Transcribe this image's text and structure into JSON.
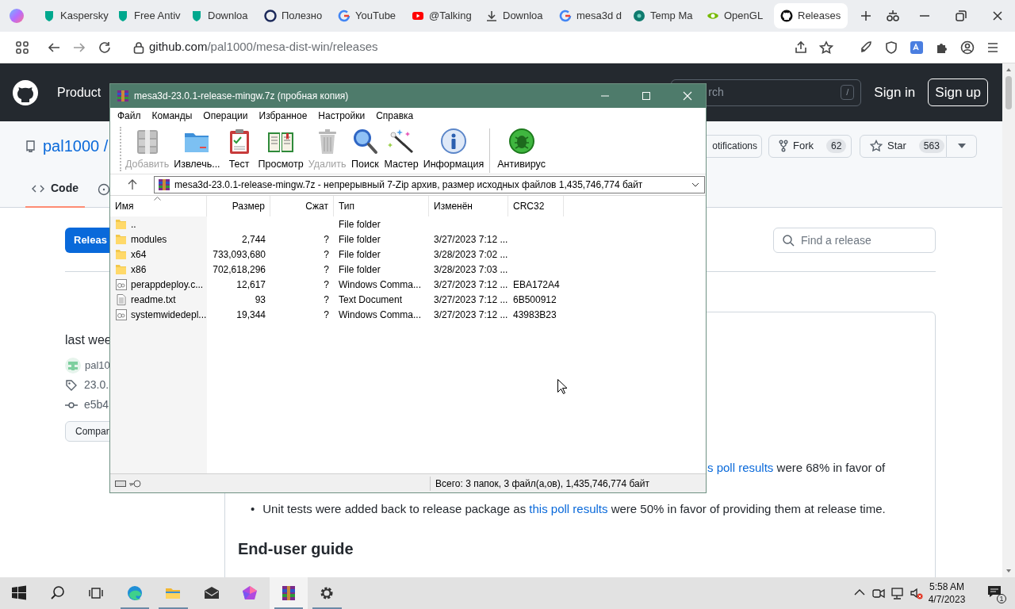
{
  "browser": {
    "tabs": [
      {
        "label": "Kaspersky",
        "selected": false
      },
      {
        "label": "Free Antiv",
        "selected": false
      },
      {
        "label": "Downloa",
        "selected": false
      },
      {
        "label": "Полезно",
        "selected": false
      },
      {
        "label": "YouTube",
        "selected": false
      },
      {
        "label": "@Talking",
        "selected": false
      },
      {
        "label": "Downloa",
        "selected": false
      },
      {
        "label": "mesa3d d",
        "selected": false
      },
      {
        "label": "Temp Ma",
        "selected": false
      },
      {
        "label": "OpenGL",
        "selected": false
      },
      {
        "label": "Releases",
        "selected": true
      }
    ],
    "url": {
      "host": "github.com",
      "path": "/pal1000/mesa-dist-win/releases"
    }
  },
  "github": {
    "header": {
      "menu": "Product",
      "search_text": "rch",
      "search_key": "/",
      "sign_in": "Sign in",
      "sign_up": "Sign up"
    },
    "repo": {
      "owner": "pal1000 /",
      "notifications": "otifications",
      "fork": {
        "label": "Fork",
        "count": "62"
      },
      "star": {
        "label": "Star",
        "count": "563"
      },
      "tabs": [
        {
          "label": "Code",
          "selected": true
        }
      ]
    },
    "releases_button": "Releas",
    "find_placeholder": "Find a release",
    "release": {
      "time": "last wee",
      "author": "pal10",
      "tag": "23.0.",
      "commit": "e5b4",
      "compare": "Compar"
    },
    "notes": {
      "partial_line": [
        {
          "text": "s poll results",
          "link": true
        },
        {
          "text": " were 68% in favor of",
          "link": false
        }
      ],
      "bullets": [
        {
          "marker": "•",
          "segments": [
            {
              "text": "Unit tests were added back to release package as ",
              "link": false
            },
            {
              "text": "this poll results",
              "link": true
            },
            {
              "text": " were 50% in favor of providing them at release time.",
              "link": false
            }
          ]
        }
      ],
      "heading": "End-user guide"
    }
  },
  "winrar": {
    "title": "mesa3d-23.0.1-release-mingw.7z (пробная копия)",
    "menu": [
      "Файл",
      "Команды",
      "Операции",
      "Избранное",
      "Настройки",
      "Справка"
    ],
    "toolbar": [
      {
        "label": "Добавить",
        "disabled": true,
        "separator_before": false
      },
      {
        "label": "Извлечь...",
        "disabled": false,
        "separator_before": false
      },
      {
        "label": "Тест",
        "disabled": false,
        "separator_before": false
      },
      {
        "label": "Просмотр",
        "disabled": false,
        "separator_before": false
      },
      {
        "label": "Удалить",
        "disabled": true,
        "separator_before": false
      },
      {
        "label": "Поиск",
        "disabled": false,
        "separator_before": false
      },
      {
        "label": "Мастер",
        "disabled": false,
        "separator_before": false
      },
      {
        "label": "Информация",
        "disabled": false,
        "separator_before": false
      },
      {
        "label": "Антивирус",
        "disabled": false,
        "separator_before": true
      }
    ],
    "path": "mesa3d-23.0.1-release-mingw.7z - непрерывный 7-Zip архив, размер исходных файлов 1,435,746,774 байт",
    "columns": [
      {
        "label": "Имя",
        "sorted": true
      },
      {
        "label": "Размер",
        "sorted": false
      },
      {
        "label": "Сжат",
        "sorted": false
      },
      {
        "label": "Тип",
        "sorted": false
      },
      {
        "label": "Изменён",
        "sorted": false
      },
      {
        "label": "CRC32",
        "sorted": false
      }
    ],
    "files": [
      {
        "kind": "folder",
        "name": "..",
        "type": "File folder"
      },
      {
        "kind": "folder",
        "name": "modules",
        "size": "2,744",
        "packed": "?",
        "type": "File folder",
        "modified": "3/27/2023 7:12 ..."
      },
      {
        "kind": "folder",
        "name": "x64",
        "size": "733,093,680",
        "packed": "?",
        "type": "File folder",
        "modified": "3/28/2023 7:02 ..."
      },
      {
        "kind": "folder",
        "name": "x86",
        "size": "702,618,296",
        "packed": "?",
        "type": "File folder",
        "modified": "3/28/2023 7:03 ..."
      },
      {
        "kind": "script",
        "name": "perappdeploy.c...",
        "size": "12,617",
        "packed": "?",
        "type": "Windows Comma...",
        "modified": "3/27/2023 7:12 ...",
        "crc": "EBA172A4"
      },
      {
        "kind": "text",
        "name": "readme.txt",
        "size": "93",
        "packed": "?",
        "type": "Text Document",
        "modified": "3/27/2023 7:12 ...",
        "crc": "6B500912"
      },
      {
        "kind": "script",
        "name": "systemwidedepl...",
        "size": "19,344",
        "packed": "?",
        "type": "Windows Comma...",
        "modified": "3/27/2023 7:12 ...",
        "crc": "43983B23"
      }
    ],
    "status": "Всего: 3 папок, 3 файл(а,ов), 1,435,746,774 байт"
  },
  "taskbar": {
    "apps": [
      {
        "running": false,
        "selected": false
      },
      {
        "running": false,
        "selected": false
      },
      {
        "running": false,
        "selected": false
      },
      {
        "running": true,
        "selected": false
      },
      {
        "running": true,
        "selected": false
      },
      {
        "running": false,
        "selected": false
      },
      {
        "running": false,
        "selected": false
      },
      {
        "running": true,
        "selected": true
      },
      {
        "running": true,
        "selected": false
      }
    ],
    "time": "5:58 AM",
    "date": "4/7/2023",
    "notifications": "1"
  }
}
